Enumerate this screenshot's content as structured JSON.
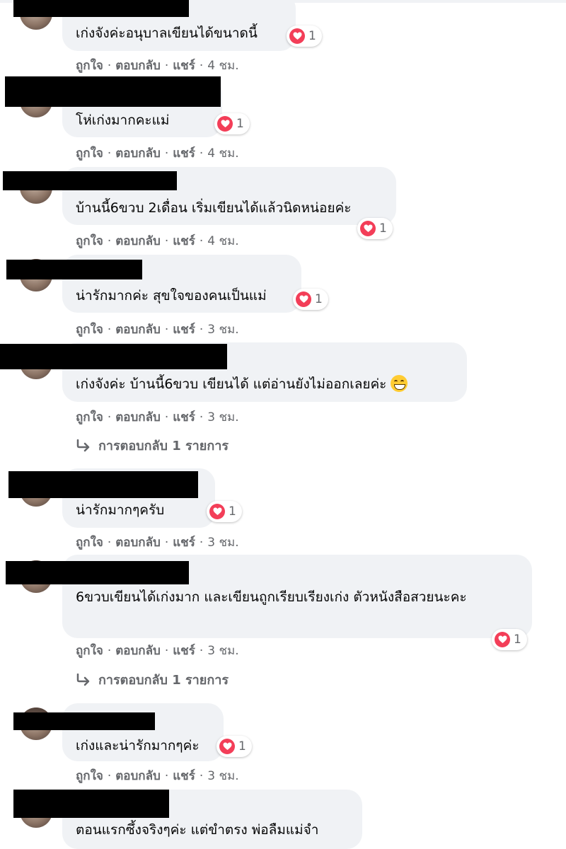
{
  "actions": {
    "like": "ถูกใจ",
    "reply": "ตอบกลับ",
    "share": "แชร์",
    "separator": "·"
  },
  "reply_link": "การตอบกลับ 1 รายการ",
  "reaction_color": "#f33e58",
  "comments": [
    {
      "text": "เก่งจังค่ะอนุบาลเขียนได้ขนาดนี้",
      "reactions": "1",
      "time": "4 ชม."
    },
    {
      "text": "โห่เก่งมากคะแม่",
      "reactions": "1",
      "time": "4 ชม."
    },
    {
      "text": "บ้านนี้6ขวบ 2เดื่อน เริ่มเขียนได้แล้วนิดหน่อยค่ะ",
      "reactions": "1",
      "time": "4 ชม."
    },
    {
      "text": "น่ารักมากค่ะ สุขใจของคนเป็นแม่",
      "reactions": "1",
      "time": "3 ชม."
    },
    {
      "text": "เก่งจังค่ะ บ้านนี้6ขวบ เขียนได้ แต่อ่านยังไม่ออกเลยค่ะ",
      "emoji": "grinning-face-icon",
      "time": "3 ชม."
    },
    {
      "text": "น่ารักมากๆครับ",
      "reactions": "1",
      "time": "3 ชม."
    },
    {
      "text": "6ขวบเขียนได้เก่งมาก และเขียนถูกเรียบเรียงเก่ง ตัวหนังสือสวยนะคะ",
      "reactions": "1",
      "time": "3 ชม."
    },
    {
      "text": "เก่งและน่ารักมากๆค่ะ",
      "reactions": "1",
      "time": "3 ชม."
    },
    {
      "text": "ตอนแรกซึ้งจริงๆค่ะ แต่ขำตรง พ่อลืมแม่จำ"
    }
  ]
}
